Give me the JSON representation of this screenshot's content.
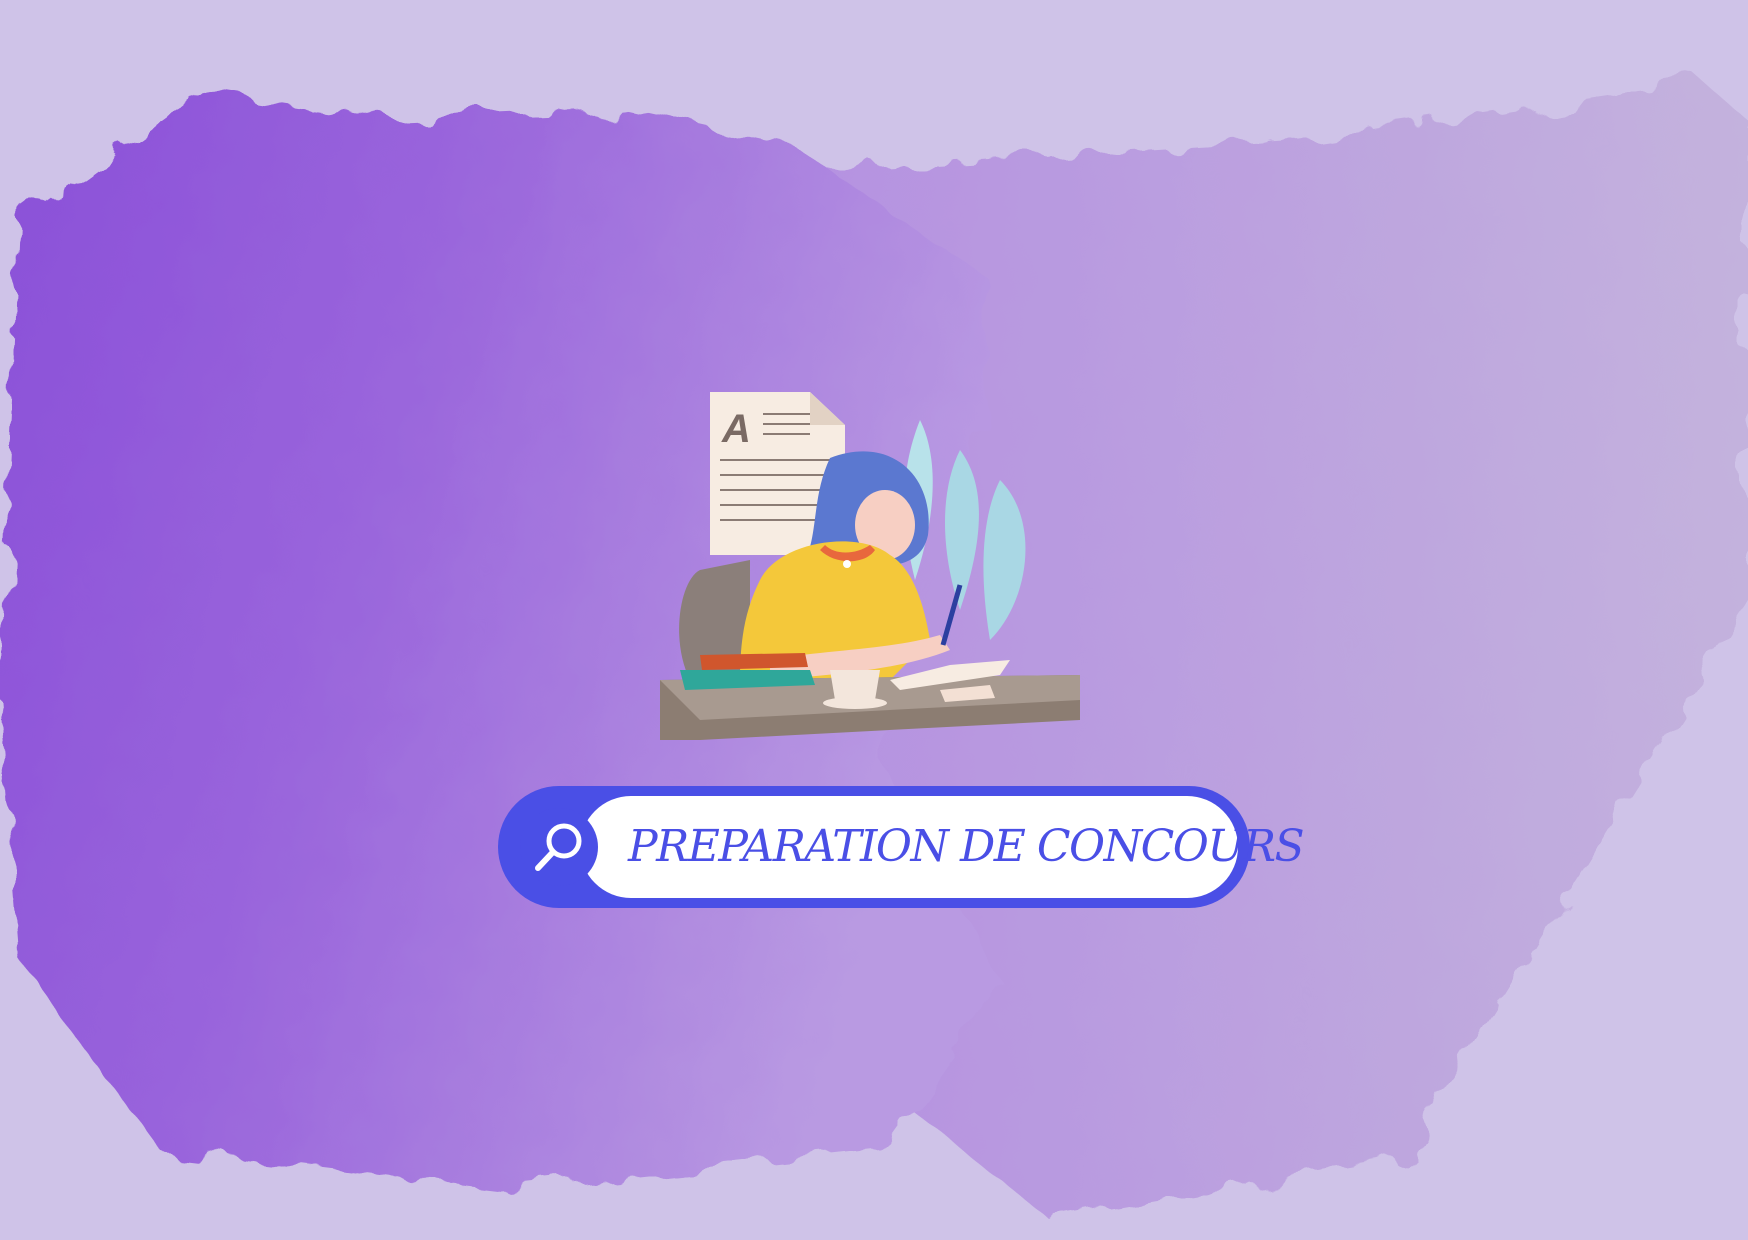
{
  "background": {
    "base_color": "#cfc3e8",
    "brush_colors": [
      "#8a4fd8",
      "#a97ee0",
      "#bba6dc"
    ]
  },
  "illustration": {
    "description_icon": "student-writing-at-desk-icon",
    "document_letter": "A"
  },
  "search_bar": {
    "icon": "search-icon",
    "text": "PREPARATION DE CONCOURS",
    "accent_color": "#4a4fe6"
  }
}
